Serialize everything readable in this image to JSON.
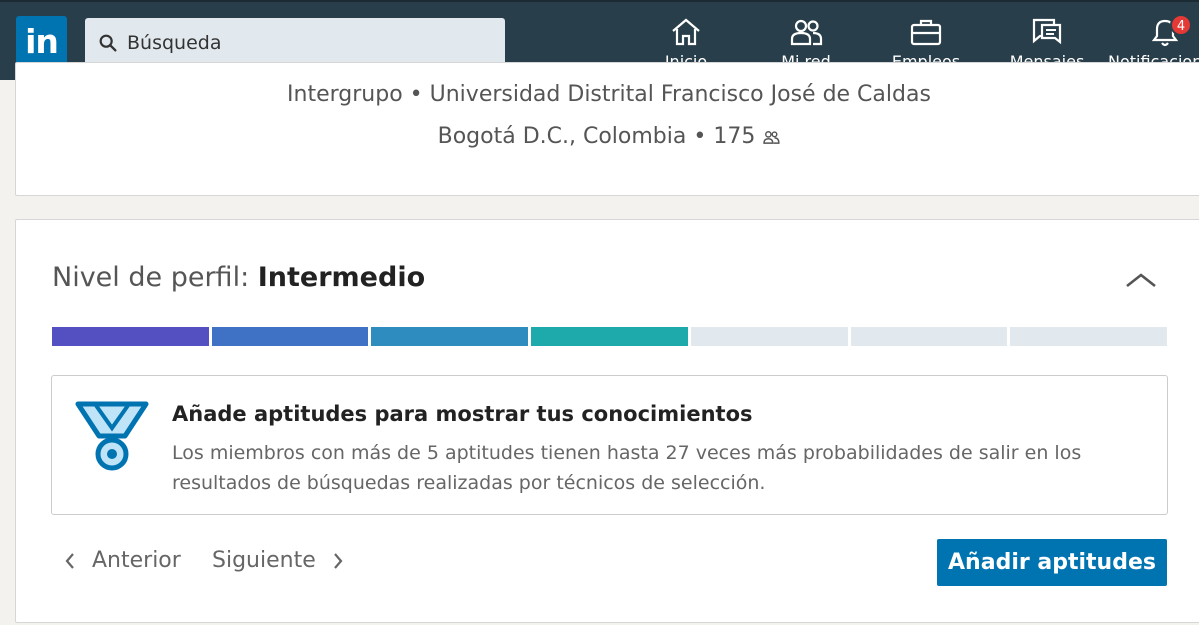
{
  "nav": {
    "logo": "in",
    "search_placeholder": "Búsqueda",
    "items": [
      {
        "label": "Inicio",
        "icon": "home-icon"
      },
      {
        "label": "Mi red",
        "icon": "people-icon"
      },
      {
        "label": "Empleos",
        "icon": "briefcase-icon"
      },
      {
        "label": "Mensajes",
        "icon": "messages-icon"
      },
      {
        "label": "Notificaciones",
        "icon": "bell-icon",
        "badge": "4"
      }
    ]
  },
  "profile": {
    "company_school": "Intergrupo • Universidad Distrital Francisco José de Caldas",
    "location": "Bogotá D.C., Colombia",
    "connections": "175"
  },
  "strength": {
    "label": "Nivel de perfil: ",
    "level": "Intermedio",
    "progress_filled": 4,
    "progress_total": 7,
    "colors": [
      "#5550c1",
      "#3f72c4",
      "#2e8cbf",
      "#1eaaab"
    ],
    "empty_color": "#e1e9ee",
    "tip_title": "Añade aptitudes para mostrar tus conocimientos",
    "tip_body": "Los miembros con más de 5 aptitudes tienen hasta 27 veces más probabilidades de salir en los resultados de búsquedas realizadas por técnicos de selección.",
    "prev_label": "Anterior",
    "next_label": "Siguiente",
    "action_label": "Añadir aptitudes"
  }
}
